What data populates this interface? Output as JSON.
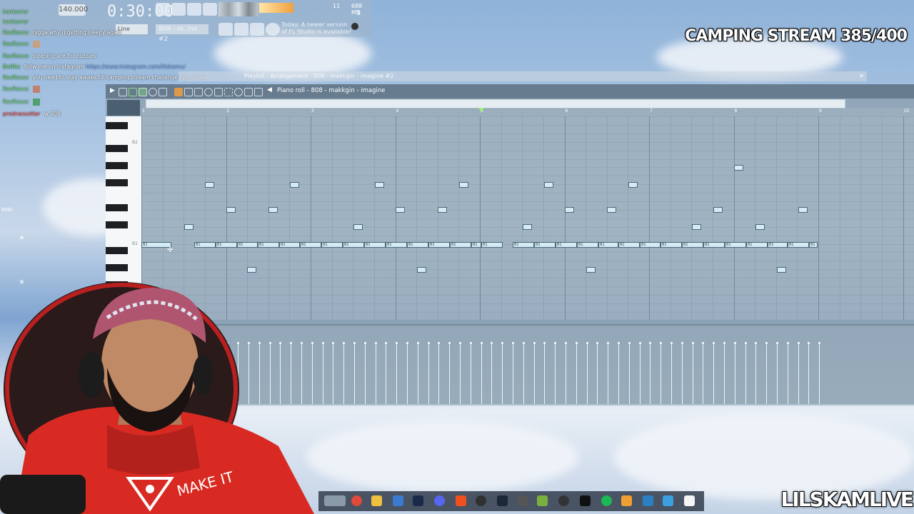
{
  "stream": {
    "title": "CAMPING STREAM 385/400",
    "channel": "LILSKAMLIVE"
  },
  "fl_toolbar": {
    "time": "0:30:00",
    "tempo": "140.000",
    "snap": "Line",
    "pattern": "808 - m..ine #2",
    "news": "Today: A newer version of FL Studio is available!",
    "cpu_value": "11",
    "memory": "688 MB",
    "voices": "3"
  },
  "chat": [
    {
      "user": "konkorror",
      "text": "",
      "user_color": "#6fe07a"
    },
    {
      "user": "konkorror",
      "text": "",
      "user_color": "#6fe07a"
    },
    {
      "user": "RoxRoxxx",
      "text": "nigga why u getting sleepy again",
      "user_color": "#6fe07a"
    },
    {
      "user": "RoxRoxxx",
      "text": "",
      "user_color": "#6fe07a"
    },
    {
      "user": "RoxRoxxx",
      "text": "sleeping are for pussies",
      "user_color": "#6fe07a"
    },
    {
      "user": "BotRix",
      "text": "follw me on instagram",
      "link": "https://www.instagram.com/lilskamu/",
      "user_color": "#6fe07a"
    },
    {
      "user": "RoxRoxxx",
      "text": "you need to stay awake till camping stream challenge type shee",
      "user_color": "#6fe07a"
    },
    {
      "user": "RoxRoxxx",
      "text": "",
      "user_color": "#6fe07a"
    },
    {
      "user": "RoxRoxxx",
      "text": "",
      "user_color": "#6fe07a"
    },
    {
      "user": "prodnessotter",
      "text": "w 808",
      "user_color": "#ff5050"
    }
  ],
  "playlist": {
    "title": "Playlist - Arrangement - 808 - makkgin - imagine #2"
  },
  "piano_roll": {
    "title": "Piano roll - 808 - makkgin - imagine",
    "bar_numbers": [
      "1",
      "2",
      "3",
      "4",
      "5",
      "6",
      "7",
      "8",
      "9",
      "10"
    ],
    "key_labels": [
      "B2",
      "B1"
    ],
    "note_label": "B1",
    "side_label": "808)"
  },
  "colors": {
    "note_fill": "#d3ecf4",
    "note_border": "#4e6878",
    "grid": "#a8bac8"
  },
  "icons": [
    "play-icon",
    "stop-icon",
    "record-icon",
    "pencil-icon",
    "brush-icon",
    "select-icon",
    "zoom-icon",
    "speaker-icon",
    "magnet-icon",
    "close-icon"
  ]
}
